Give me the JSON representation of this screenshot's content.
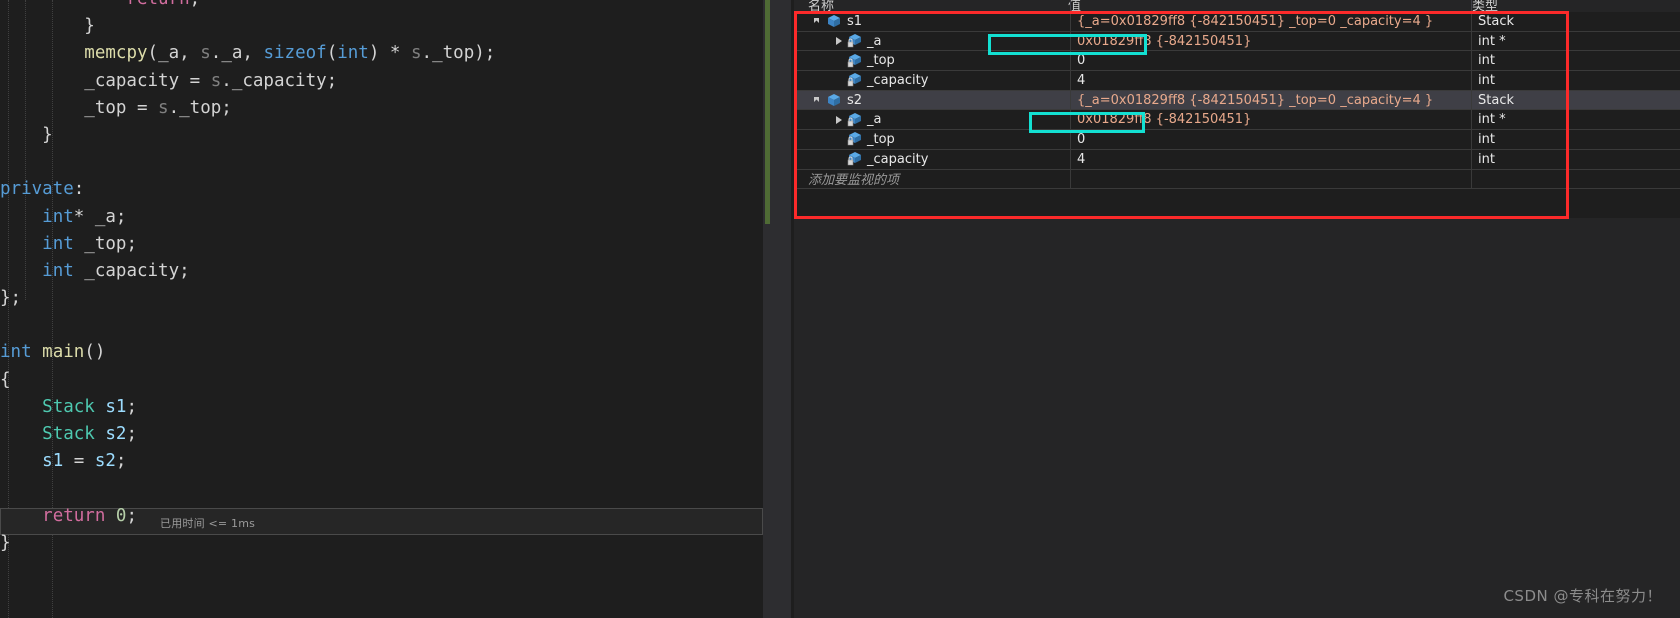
{
  "editor": {
    "elapsed_label": "已用时间 <= 1ms",
    "lines": [
      {
        "indent": 0,
        "tokens": [
          {
            "t": "            ",
            "c": "plain"
          },
          {
            "t": "return",
            "c": "kw-pink"
          },
          {
            "t": ";",
            "c": "punct"
          }
        ]
      },
      {
        "indent": 0,
        "tokens": [
          {
            "t": "        }",
            "c": "punct"
          }
        ]
      },
      {
        "indent": 0,
        "tokens": [
          {
            "t": "        ",
            "c": "plain"
          },
          {
            "t": "memcpy",
            "c": "fn"
          },
          {
            "t": "(",
            "c": "punct"
          },
          {
            "t": "_a",
            "c": "plain"
          },
          {
            "t": ", ",
            "c": "punct"
          },
          {
            "t": "s",
            "c": "dim"
          },
          {
            "t": ".",
            "c": "punct"
          },
          {
            "t": "_a",
            "c": "plain"
          },
          {
            "t": ", ",
            "c": "punct"
          },
          {
            "t": "sizeof",
            "c": "kw"
          },
          {
            "t": "(",
            "c": "punct"
          },
          {
            "t": "int",
            "c": "kw"
          },
          {
            "t": ") * ",
            "c": "punct"
          },
          {
            "t": "s",
            "c": "dim"
          },
          {
            "t": ".",
            "c": "punct"
          },
          {
            "t": "_top",
            "c": "plain"
          },
          {
            "t": ");",
            "c": "punct"
          }
        ]
      },
      {
        "indent": 0,
        "tokens": [
          {
            "t": "        _capacity = ",
            "c": "plain"
          },
          {
            "t": "s",
            "c": "dim"
          },
          {
            "t": ".",
            "c": "punct"
          },
          {
            "t": "_capacity",
            "c": "plain"
          },
          {
            "t": ";",
            "c": "punct"
          }
        ]
      },
      {
        "indent": 0,
        "tokens": [
          {
            "t": "        _top = ",
            "c": "plain"
          },
          {
            "t": "s",
            "c": "dim"
          },
          {
            "t": ".",
            "c": "punct"
          },
          {
            "t": "_top",
            "c": "plain"
          },
          {
            "t": ";",
            "c": "punct"
          }
        ]
      },
      {
        "indent": 0,
        "tokens": [
          {
            "t": "    }",
            "c": "punct"
          }
        ]
      },
      {
        "indent": 0,
        "tokens": [
          {
            "t": "",
            "c": "plain"
          }
        ]
      },
      {
        "indent": 0,
        "tokens": [
          {
            "t": "private",
            "c": "kw"
          },
          {
            "t": ":",
            "c": "punct"
          }
        ]
      },
      {
        "indent": 0,
        "tokens": [
          {
            "t": "    ",
            "c": "plain"
          },
          {
            "t": "int",
            "c": "kw"
          },
          {
            "t": "* _a;",
            "c": "plain"
          }
        ]
      },
      {
        "indent": 0,
        "tokens": [
          {
            "t": "    ",
            "c": "plain"
          },
          {
            "t": "int",
            "c": "kw"
          },
          {
            "t": " _top;",
            "c": "plain"
          }
        ]
      },
      {
        "indent": 0,
        "tokens": [
          {
            "t": "    ",
            "c": "plain"
          },
          {
            "t": "int",
            "c": "kw"
          },
          {
            "t": " _capacity;",
            "c": "plain"
          }
        ]
      },
      {
        "indent": 0,
        "tokens": [
          {
            "t": "};",
            "c": "punct"
          }
        ]
      },
      {
        "indent": 0,
        "tokens": [
          {
            "t": "",
            "c": "plain"
          }
        ]
      },
      {
        "indent": 0,
        "tokens": [
          {
            "t": "int",
            "c": "kw"
          },
          {
            "t": " ",
            "c": "plain"
          },
          {
            "t": "main",
            "c": "fn"
          },
          {
            "t": "()",
            "c": "punct"
          }
        ]
      },
      {
        "indent": 0,
        "tokens": [
          {
            "t": "{",
            "c": "punct"
          }
        ]
      },
      {
        "indent": 0,
        "tokens": [
          {
            "t": "    ",
            "c": "plain"
          },
          {
            "t": "Stack",
            "c": "type"
          },
          {
            "t": " ",
            "c": "plain"
          },
          {
            "t": "s1",
            "c": "var"
          },
          {
            "t": ";",
            "c": "punct"
          }
        ]
      },
      {
        "indent": 0,
        "tokens": [
          {
            "t": "    ",
            "c": "plain"
          },
          {
            "t": "Stack",
            "c": "type"
          },
          {
            "t": " ",
            "c": "plain"
          },
          {
            "t": "s2",
            "c": "var"
          },
          {
            "t": ";",
            "c": "punct"
          }
        ]
      },
      {
        "indent": 0,
        "tokens": [
          {
            "t": "    ",
            "c": "plain"
          },
          {
            "t": "s1",
            "c": "var"
          },
          {
            "t": " = ",
            "c": "punct"
          },
          {
            "t": "s2",
            "c": "var"
          },
          {
            "t": ";",
            "c": "punct"
          }
        ]
      },
      {
        "indent": 0,
        "tokens": [
          {
            "t": "",
            "c": "plain"
          }
        ]
      },
      {
        "indent": 0,
        "tokens": [
          {
            "t": "    ",
            "c": "plain"
          },
          {
            "t": "return",
            "c": "kw-pink"
          },
          {
            "t": " ",
            "c": "plain"
          },
          {
            "t": "0",
            "c": "num"
          },
          {
            "t": ";",
            "c": "punct"
          }
        ]
      },
      {
        "indent": 0,
        "tokens": [
          {
            "t": "}",
            "c": "punct"
          }
        ]
      }
    ]
  },
  "watch": {
    "columns": {
      "name": "名称",
      "value": "值",
      "type": "类型"
    },
    "placeholder": "添加要监视的项",
    "rows": [
      {
        "depth": 0,
        "twisty": "expanded",
        "icon": "struct-icon",
        "name": "s1",
        "value": "{_a=0x01829ff8 {-842150451} _top=0 _capacity=4 }",
        "type": "Stack",
        "selected": false,
        "value_style": "expr"
      },
      {
        "depth": 1,
        "twisty": "collapsed",
        "icon": "field-private-icon",
        "name": "_a",
        "value": "0x01829ff8 {-842150451}",
        "type": "int *",
        "selected": false,
        "value_style": "expr"
      },
      {
        "depth": 1,
        "twisty": "none",
        "icon": "field-private-icon",
        "name": "_top",
        "value": "0",
        "type": "int",
        "selected": false,
        "value_style": "plain"
      },
      {
        "depth": 1,
        "twisty": "none",
        "icon": "field-private-icon",
        "name": "_capacity",
        "value": "4",
        "type": "int",
        "selected": false,
        "value_style": "plain"
      },
      {
        "depth": 0,
        "twisty": "expanded",
        "icon": "struct-icon",
        "name": "s2",
        "value": "{_a=0x01829ff8 {-842150451} _top=0 _capacity=4 }",
        "type": "Stack",
        "selected": true,
        "value_style": "expr"
      },
      {
        "depth": 1,
        "twisty": "collapsed",
        "icon": "field-private-icon",
        "name": "_a",
        "value": "0x01829ff8 {-842150451}",
        "type": "int *",
        "selected": false,
        "value_style": "expr"
      },
      {
        "depth": 1,
        "twisty": "none",
        "icon": "field-private-icon",
        "name": "_top",
        "value": "0",
        "type": "int",
        "selected": false,
        "value_style": "plain"
      },
      {
        "depth": 1,
        "twisty": "none",
        "icon": "field-private-icon",
        "name": "_capacity",
        "value": "4",
        "type": "int",
        "selected": false,
        "value_style": "plain"
      }
    ]
  },
  "annotations": {
    "red_box_color": "#fc2a2a",
    "cyan_box_color": "#13e0d2"
  },
  "watermark": {
    "text": "CSDN @专科在努力！"
  }
}
